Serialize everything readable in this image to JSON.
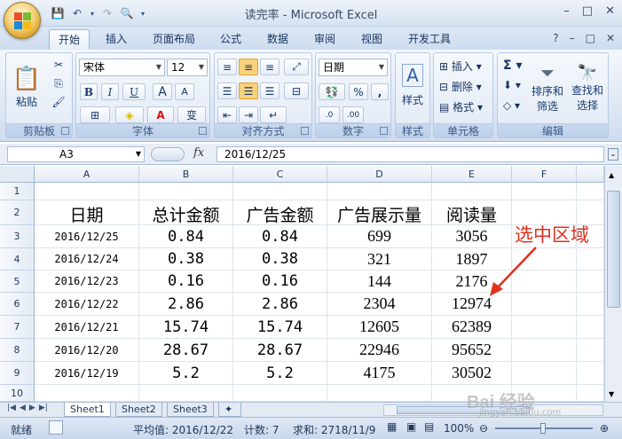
{
  "app": {
    "title": "读完率 - Microsoft Excel",
    "window_controls": [
      "–",
      "□",
      "✕"
    ]
  },
  "ribbon": {
    "tabs": [
      "开始",
      "插入",
      "页面布局",
      "公式",
      "数据",
      "审阅",
      "视图",
      "开发工具"
    ],
    "active_tab": "开始",
    "groups": {
      "clipboard": {
        "label": "剪贴板",
        "paste": "粘贴"
      },
      "font": {
        "label": "字体",
        "font_name": "宋体",
        "font_size": "12",
        "bold": "B",
        "italic": "I",
        "underline": "U"
      },
      "alignment": {
        "label": "对齐方式"
      },
      "number": {
        "label": "数字",
        "format": "日期",
        "percent": "%",
        "comma": ","
      },
      "styles": {
        "label": "样式"
      },
      "cells": {
        "label": "单元格",
        "insert": "插入",
        "delete": "删除",
        "format": "格式"
      },
      "editing": {
        "label": "编辑",
        "sort_filter": "排序和\n筛选",
        "find_select": "查找和\n选择",
        "sort_filter_1": "排序和",
        "sort_filter_2": "筛选",
        "find_select_1": "查找和",
        "find_select_2": "选择"
      }
    }
  },
  "formula_bar": {
    "name_box": "A3",
    "fx": "fx",
    "formula": "2016/12/25"
  },
  "sheet": {
    "columns": [
      "A",
      "B",
      "C",
      "D",
      "E",
      "F"
    ],
    "rows": [
      "1",
      "2",
      "3",
      "4",
      "5",
      "6",
      "7",
      "8",
      "9",
      "10"
    ],
    "header_row": [
      "日期",
      "总计金额",
      "广告金额",
      "广告展示量",
      "阅读量"
    ],
    "data": [
      [
        "2016/12/25",
        "0.84",
        "0.84",
        "699",
        "3056"
      ],
      [
        "2016/12/24",
        "0.38",
        "0.38",
        "321",
        "1897"
      ],
      [
        "2016/12/23",
        "0.16",
        "0.16",
        "144",
        "2176"
      ],
      [
        "2016/12/22",
        "2.86",
        "2.86",
        "2304",
        "12974"
      ],
      [
        "2016/12/21",
        "15.74",
        "15.74",
        "12605",
        "62389"
      ],
      [
        "2016/12/20",
        "28.67",
        "28.67",
        "22946",
        "95652"
      ],
      [
        "2016/12/19",
        "5.2",
        "5.2",
        "4175",
        "30502"
      ]
    ],
    "annotation": "选中区域",
    "annotation_color": "#e0301e"
  },
  "sheet_tabs": [
    "Sheet1",
    "Sheet2",
    "Sheet3"
  ],
  "active_sheet": "Sheet1",
  "status_bar": {
    "mode": "就绪",
    "average": "平均值: 2016/12/22",
    "count": "计数: 7",
    "sum": "求和: 2718/11/9",
    "zoom": "100%"
  },
  "watermark": {
    "main": "Bai 经验",
    "sub": "jingyan.baidu.com"
  }
}
